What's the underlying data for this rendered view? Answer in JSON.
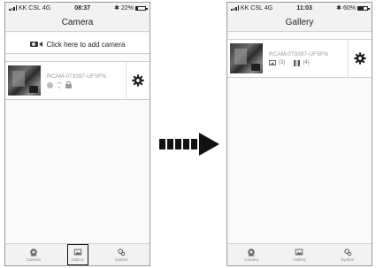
{
  "left_screen": {
    "status": {
      "carrier": "KK CSL",
      "network": "4G",
      "time": "08:37",
      "bt": "✱",
      "battery": "22%",
      "battery_level": 0.22
    },
    "title": "Camera",
    "add_camera": {
      "label": "Click here to add camera",
      "icon": "camera-icon"
    },
    "device": {
      "name": "RCAM-073397-UFSFN"
    },
    "tabs": [
      {
        "label": "Camera",
        "icon": "camera-tab-icon"
      },
      {
        "label": "Gallery",
        "icon": "gallery-tab-icon",
        "highlighted": true
      },
      {
        "label": "System",
        "icon": "gears-tab-icon"
      }
    ]
  },
  "right_screen": {
    "status": {
      "carrier": "KK CSL",
      "network": "4G",
      "time": "11:03",
      "bt": "✱",
      "battery": "60%",
      "battery_level": 0.6
    },
    "title": "Gallery",
    "device": {
      "name": "RCAM-073397-UFSFN",
      "photo_count": "(3)",
      "video_count": "(4)"
    },
    "tabs": [
      {
        "label": "Camera",
        "icon": "camera-tab-icon"
      },
      {
        "label": "Gallery",
        "icon": "gallery-tab-icon"
      },
      {
        "label": "System",
        "icon": "gears-tab-icon"
      }
    ]
  },
  "transition_arrow": {
    "icon": "dashed-arrow-right-icon",
    "color": "#111111"
  }
}
